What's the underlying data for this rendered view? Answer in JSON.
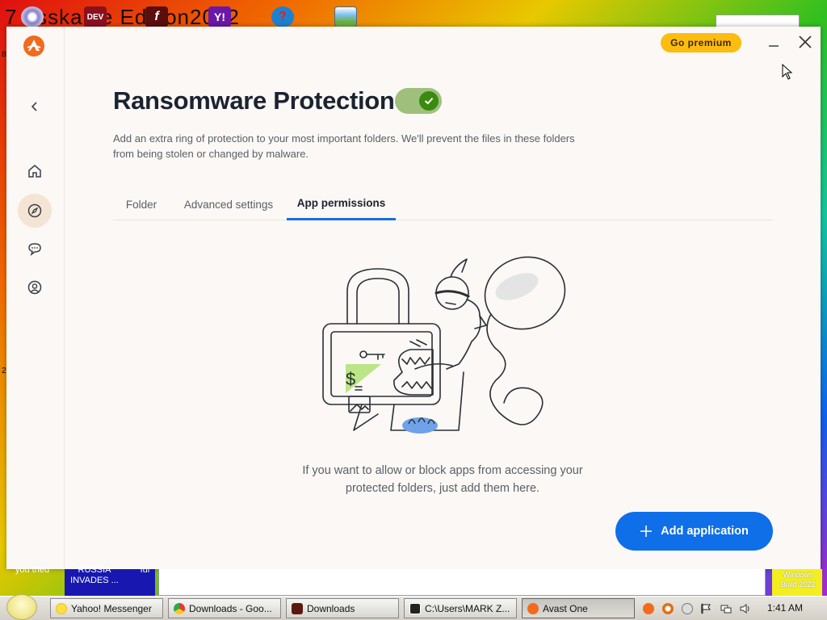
{
  "desktop": {
    "top_fragment_text": "7 osskalae Edition2012",
    "icon_dev_label": "DEV",
    "icon_labels_left": "you tried",
    "icon_russia": "RUSSIA\nINVADES ...",
    "icon_fur": "fur",
    "side_fragment_1": "B",
    "side_fragment_2": "2",
    "corner_badge": "Windows\nBuild 2022"
  },
  "app": {
    "premium_label": "Go premium",
    "title": "Ransomware Protection",
    "description": "Add an extra ring of protection to your most important folders. We'll prevent the files in these folders from being stolen or changed by malware.",
    "tabs": [
      {
        "label": "Folder"
      },
      {
        "label": "Advanced settings"
      },
      {
        "label": "App permissions"
      }
    ],
    "active_tab": "App permissions",
    "toggle_on": true,
    "illustration_symbol": "$",
    "empty_text_line1": "If you want to allow or block apps from accessing your",
    "empty_text_line2": "protected folders, just add them here.",
    "add_button_label": "Add application",
    "colors": {
      "accent_blue": "#0e6fe8",
      "premium_yellow": "#fdbc10",
      "toggle_green": "#3a8a10",
      "brand_orange": "#f26a1b"
    }
  },
  "taskbar": {
    "buttons": [
      {
        "label": "Yahoo! Messenger",
        "icon": "yahoo-icon"
      },
      {
        "label": "Downloads - Goo...",
        "icon": "chrome-icon"
      },
      {
        "label": "Downloads",
        "icon": "folder-icon"
      },
      {
        "label": "C:\\Users\\MARK Z...",
        "icon": "7zip-icon"
      },
      {
        "label": "Avast One",
        "icon": "avast-icon"
      }
    ],
    "clock": "1:41 AM"
  }
}
